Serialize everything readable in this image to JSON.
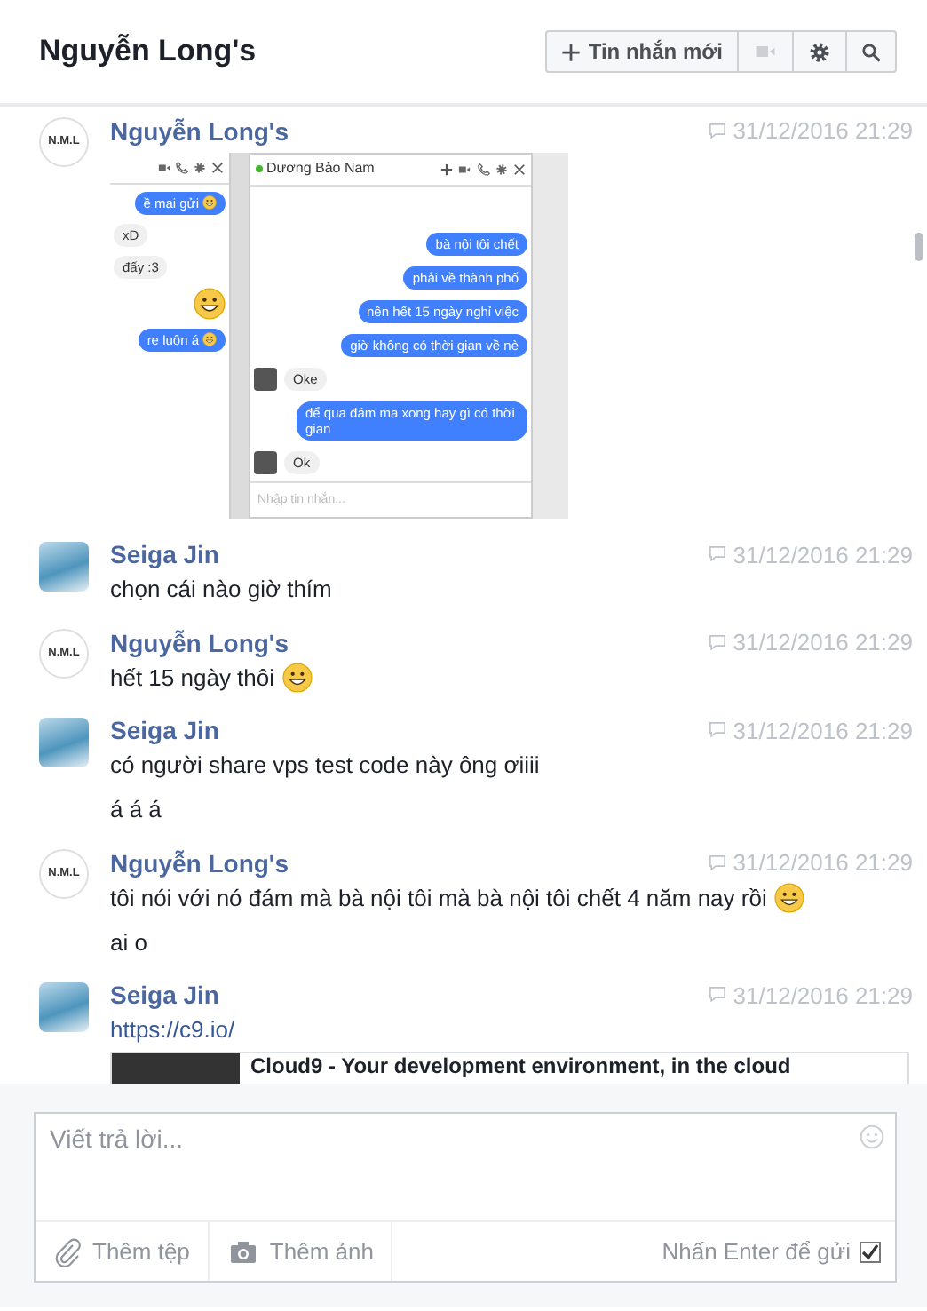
{
  "header": {
    "title": "Nguyễn Long's",
    "new_message_button": "Tin nhắn mới"
  },
  "messages": [
    {
      "sender": "Nguyễn Long's",
      "avatar": {
        "kind": "initials",
        "text": "N.M.L"
      },
      "time": "31/12/2016 21:29",
      "content": [
        {
          "kind": "screenshot",
          "left_window": {
            "bubbles": [
              {
                "kind": "sent",
                "text": "ề mai gửi",
                "emoji": true
              },
              {
                "kind": "received",
                "text": "xD",
                "emoji": false
              },
              {
                "kind": "received",
                "text": "đấy :3",
                "emoji": false
              },
              {
                "kind": "big_emoji"
              },
              {
                "kind": "sent",
                "text": "re luôn á",
                "emoji": true
              }
            ]
          },
          "right_window": {
            "title": "Dương Bảo Nam",
            "online": true,
            "messages": [
              {
                "kind": "sent",
                "text": "bà nội tôi chết"
              },
              {
                "kind": "sent",
                "text": "phải về thành phố"
              },
              {
                "kind": "sent",
                "text": "nên hết 15 ngày nghỉ việc"
              },
              {
                "kind": "sent",
                "text": "giờ không có thời gian về nè"
              },
              {
                "kind": "received",
                "text": "Oke"
              },
              {
                "kind": "sent",
                "text": "để qua đám ma xong hay gì có thời gian"
              },
              {
                "kind": "received",
                "text": "Ok"
              }
            ],
            "placeholder": "Nhập tin nhắn..."
          }
        }
      ]
    },
    {
      "sender": "Seiga Jin",
      "avatar": {
        "kind": "photo"
      },
      "time": "31/12/2016 21:29",
      "content": [
        {
          "kind": "text",
          "text": "chọn cái nào giờ thím",
          "emoji": false
        }
      ]
    },
    {
      "sender": "Nguyễn Long's",
      "avatar": {
        "kind": "initials",
        "text": "N.M.L"
      },
      "time": "31/12/2016 21:29",
      "content": [
        {
          "kind": "text",
          "text": "hết 15 ngày thôi",
          "emoji": true
        }
      ]
    },
    {
      "sender": "Seiga Jin",
      "avatar": {
        "kind": "photo"
      },
      "time": "31/12/2016 21:29",
      "content": [
        {
          "kind": "text",
          "text": "có người share vps test code này ông ơiiii",
          "emoji": false
        },
        {
          "kind": "text",
          "text": "á á á",
          "emoji": false
        }
      ]
    },
    {
      "sender": "Nguyễn Long's",
      "avatar": {
        "kind": "initials",
        "text": "N.M.L"
      },
      "time": "31/12/2016 21:29",
      "content": [
        {
          "kind": "text",
          "text": "tôi nói với nó đám mà bà nội tôi mà bà nội tôi chết 4 năm nay rồi",
          "emoji": true
        },
        {
          "kind": "text",
          "text": "ai o",
          "emoji": false
        }
      ]
    },
    {
      "sender": "Seiga Jin",
      "avatar": {
        "kind": "photo"
      },
      "time": "31/12/2016 21:29",
      "content": [
        {
          "kind": "link",
          "text": "https://c9.io/"
        },
        {
          "kind": "link_preview",
          "title": "Cloud9 - Your development environment, in the cloud"
        }
      ]
    }
  ],
  "composer": {
    "placeholder": "Viết trả lời...",
    "attach_file": "Thêm tệp",
    "attach_photo": "Thêm ảnh",
    "enter_to_send": "Nhấn Enter để gửi",
    "enter_to_send_checked": true
  }
}
